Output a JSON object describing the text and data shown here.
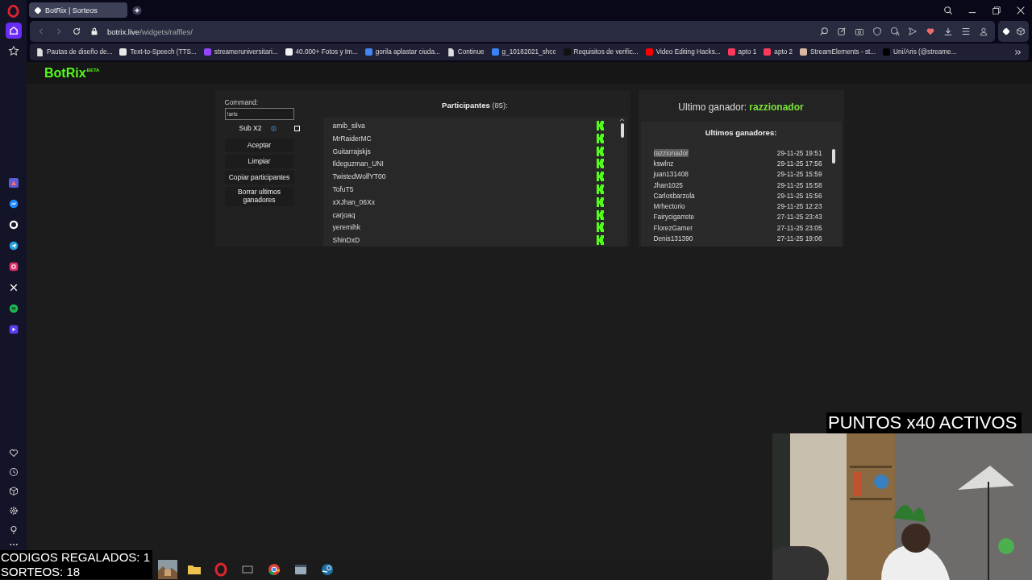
{
  "browser": {
    "tabs": [
      {
        "title": "BotRix | Sorteos",
        "selected": true
      }
    ],
    "url_host": "botrix.live",
    "url_path": "/widgets/raffles/",
    "bookmarks": [
      {
        "label": "Pautas de diseño de...",
        "kind": "page"
      },
      {
        "label": "Text-to-Speech (TTS...",
        "kind": "logo",
        "color": "#e8e8e8"
      },
      {
        "label": "streameruniversitari...",
        "kind": "logo",
        "color": "#9146ff"
      },
      {
        "label": "40.000+ Fotos y Im...",
        "kind": "logo",
        "color": "#f2f2f2"
      },
      {
        "label": "gorila aplastar ciuda...",
        "kind": "logo",
        "color": "#4285f4"
      },
      {
        "label": "Continue",
        "kind": "page"
      },
      {
        "label": "g_10182021_shcc",
        "kind": "logo",
        "color": "#3b82f6"
      },
      {
        "label": "Requisitos de verific...",
        "kind": "logo",
        "color": "#111111"
      },
      {
        "label": "Video Editing Hacks...",
        "kind": "logo",
        "color": "#ff0000"
      },
      {
        "label": "apto 1",
        "kind": "logo",
        "color": "#ff385c"
      },
      {
        "label": "apto 2",
        "kind": "logo",
        "color": "#ff385c"
      },
      {
        "label": "StreamElements - st...",
        "kind": "logo",
        "color": "#d9b8a0"
      },
      {
        "label": "Uni/Aris (@streame...",
        "kind": "logo",
        "color": "#000000"
      }
    ]
  },
  "botrix": {
    "logo": "BotRix",
    "badge": "BETA"
  },
  "controls": {
    "command_label": "Command:",
    "command_value": "!aris",
    "sub_label": "Sub X2",
    "sub_checked": false,
    "buttons": [
      "Aceptar",
      "Limpiar",
      "Copiar participantes",
      "Borrar ultimos ganadores"
    ]
  },
  "participants": {
    "title": "Participantes",
    "count": "(85):",
    "names": [
      "amib_silva",
      "MrRaiderMC",
      "Guitarrajskjs",
      "Ildeguzman_UNI",
      "TwistedWolfYT00",
      "TofuT5",
      "xXJhan_06Xx",
      "carjoaq",
      "yeremihk",
      "ShinDxD"
    ]
  },
  "last_winner": {
    "label": "Ultimo ganador:",
    "name": "razzionador"
  },
  "winners": {
    "title": "Ultimos ganadores:",
    "rows": [
      {
        "name": "razzionador",
        "date": "29-11-25 19:51",
        "highlighted": true
      },
      {
        "name": "kswlnz",
        "date": "29-11-25 17:56",
        "highlighted": false
      },
      {
        "name": "juan131408",
        "date": "29-11-25 15:59",
        "highlighted": false
      },
      {
        "name": "Jhan1025",
        "date": "29-11-25 15:58",
        "highlighted": false
      },
      {
        "name": "Carlosbarzola",
        "date": "29-11-25 15:56",
        "highlighted": false
      },
      {
        "name": "Mrhectorio",
        "date": "29-11-25 12:23",
        "highlighted": false
      },
      {
        "name": "Fairycigarrete",
        "date": "27-11-25 23:43",
        "highlighted": false
      },
      {
        "name": "FlorezGamer",
        "date": "27-11-25 23:05",
        "highlighted": false
      },
      {
        "name": "Denis131390",
        "date": "27-11-25 19:06",
        "highlighted": false
      }
    ]
  },
  "overlay": {
    "banner": "PUNTOS x40 ACTIVOS",
    "stats": [
      "CODIGOS REGALADOS: 1",
      "SORTEOS: 18"
    ]
  }
}
